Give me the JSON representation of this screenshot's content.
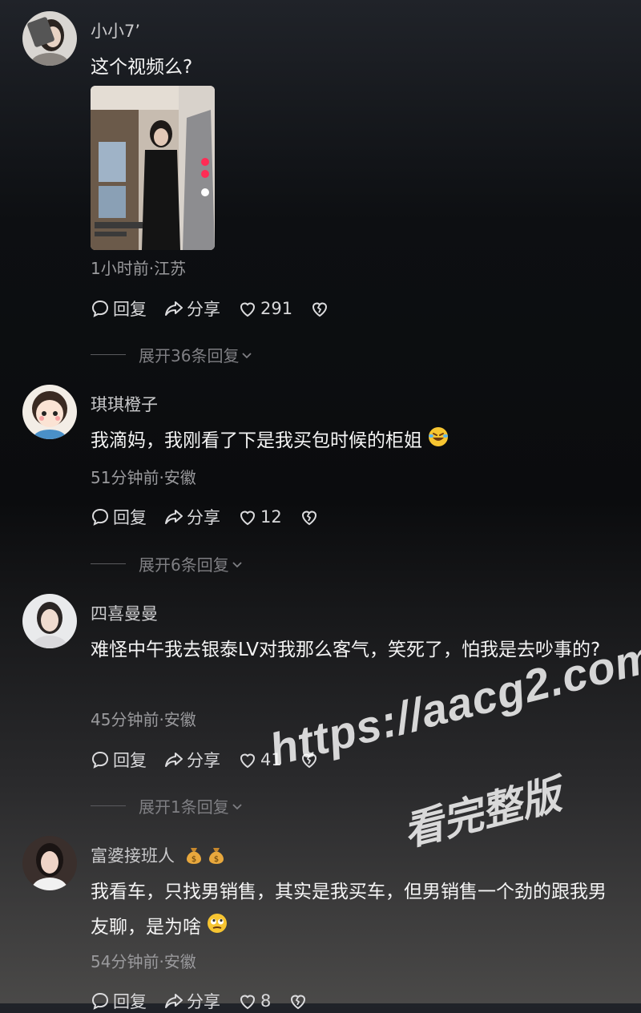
{
  "comments": [
    {
      "username": "小小7’",
      "text": "这个视频么?",
      "meta": "1小时前·江苏",
      "reply_label": "回复",
      "share_label": "分享",
      "likes": "291",
      "expand_label": "展开36条回复"
    },
    {
      "username": "琪琪橙子",
      "text": "我滴妈，我刚看了下是我买包时候的柜姐",
      "emoji": "laughing-tears-emoji",
      "meta": "51分钟前·安徽",
      "reply_label": "回复",
      "share_label": "分享",
      "likes": "12",
      "expand_label": "展开6条回复"
    },
    {
      "username": "四喜曼曼",
      "text": "难怪中午我去银泰LV对我那么客气，笑死了，怕我是去吵事的?",
      "meta": "45分钟前·安徽",
      "reply_label": "回复",
      "share_label": "分享",
      "likes": "41",
      "expand_label": "展开1条回复"
    },
    {
      "username": "富婆接班人",
      "username_emoji": "money-bag-emoji",
      "text": "我看车，只找男销售，其实是我买车，但男销售一个劲的跟我男友聊，是为啥",
      "emoji": "eye-roll-emoji",
      "meta": "54分钟前·安徽",
      "reply_label": "回复",
      "share_label": "分享",
      "likes": "8"
    }
  ],
  "watermark": {
    "url": "https://aacg2.com",
    "caption": "看完整版"
  },
  "colors": {
    "text": "#f4f4f4",
    "meta": "#9a9a9d",
    "username": "#c9c9cb"
  }
}
